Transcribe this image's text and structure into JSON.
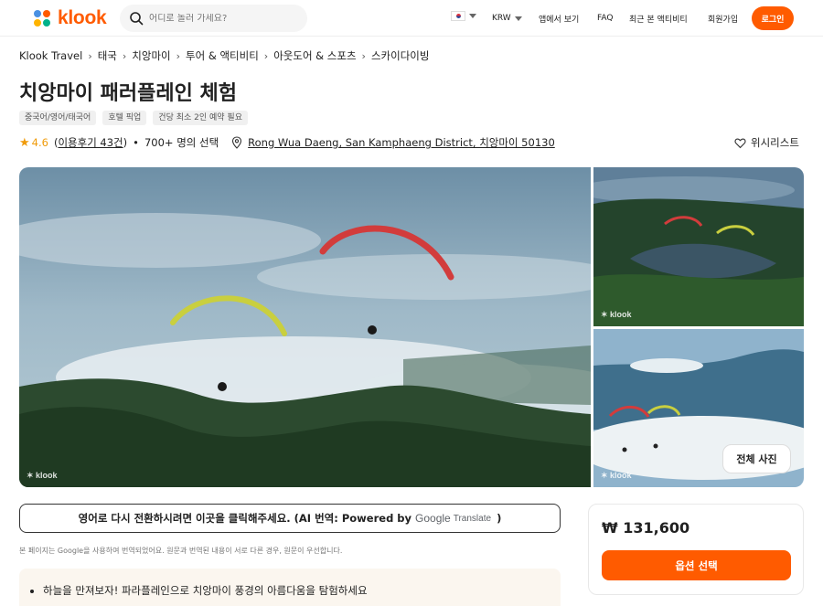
{
  "header": {
    "logo_text": "klook",
    "search_placeholder": "어디로 놀러 가세요?",
    "currency": "KRW",
    "nav": [
      "앱에서 보기",
      "FAQ",
      "최근 본 액티비티",
      "회원가입"
    ],
    "login_label": "로그인",
    "accent_color": "#ff5b00"
  },
  "breadcrumb": [
    "Klook Travel",
    "태국",
    "치앙마이",
    "투어 & 액티비티",
    "아웃도어 & 스포츠",
    "스카이다이빙"
  ],
  "title": "치앙마이 패러플레인 체험",
  "tags": [
    "중국어/영어/태국어",
    "호텔 픽업",
    "건당 최소 2인 예약 필요"
  ],
  "meta": {
    "rating": "4.6",
    "reviews": "이용후기 43건",
    "booked": "700+ 명의 선택",
    "location": "Rong Wua Daeng, San Kamphaeng District, 치앙마이 50130"
  },
  "wishlist_label": "위시리스트",
  "gallery": {
    "watermark": "klook",
    "all_photos_label": "전체 사진"
  },
  "translate": {
    "text": "영어로 다시 전환하시려면 이곳을 클릭해주세요. (AI 번역: Powered by",
    "google": "Google",
    "translate_word": "Translate",
    "close": ")"
  },
  "notice": "본 페이지는 Google을 사용하여 번역되었어요. 원문과 번역된 내용이 서로 다른 경우, 원문이 우선합니다.",
  "highlights": [
    "하늘을 만져보자! 파라플레인으로 치앙마이 풍경의 아름다움을 탐험하세요"
  ],
  "price_card": {
    "price": "₩ 131,600",
    "option_button": "옵션 선택"
  }
}
